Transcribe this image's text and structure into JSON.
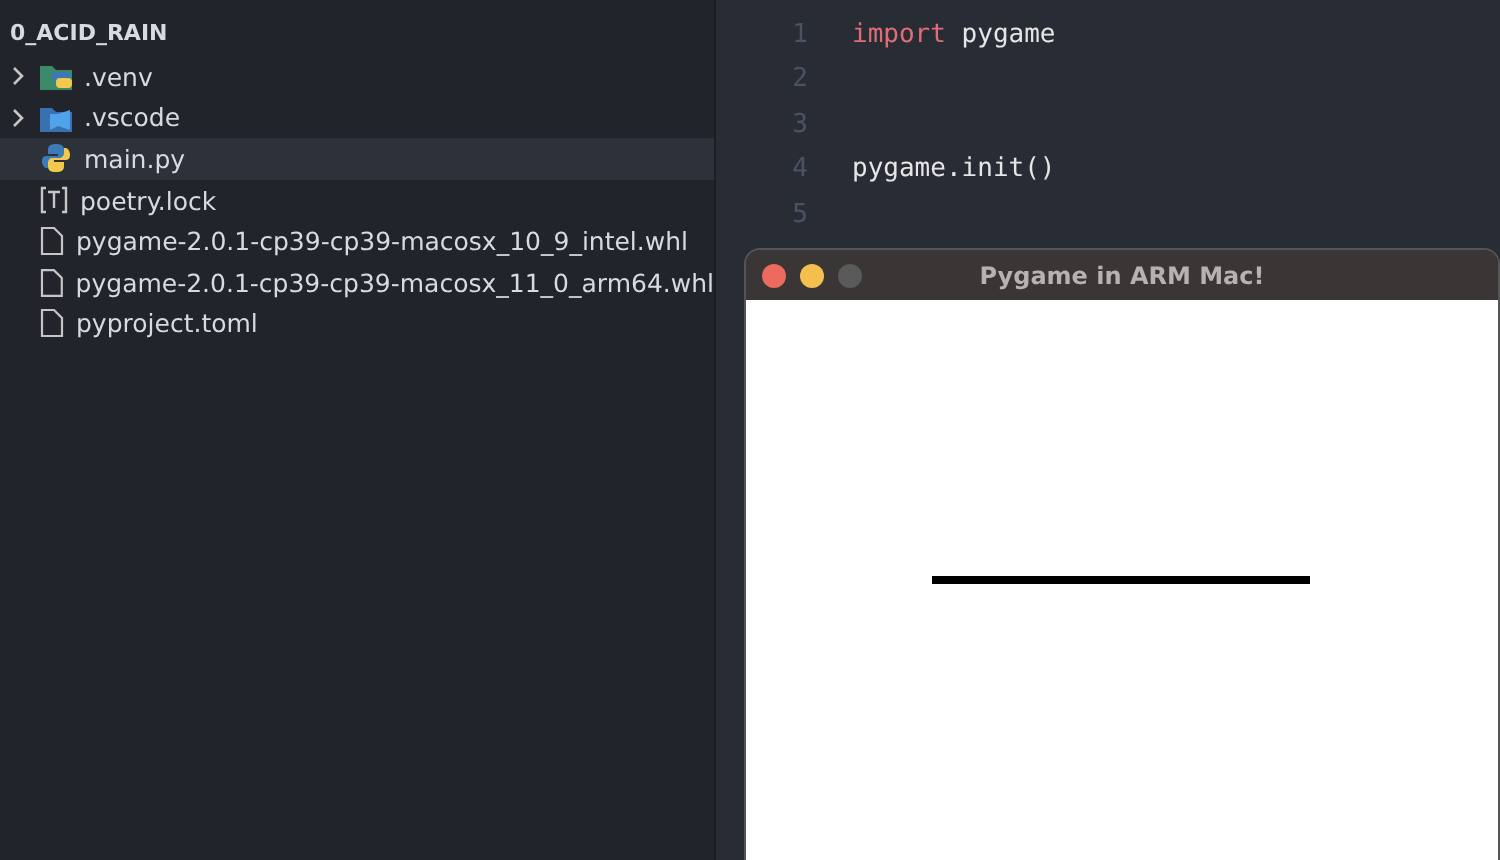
{
  "explorer": {
    "title": "0_ACID_RAIN",
    "items": [
      {
        "name": ".venv",
        "kind": "folder-python",
        "expanded": false,
        "selected": false
      },
      {
        "name": ".vscode",
        "kind": "folder-vscode",
        "expanded": false,
        "selected": false
      },
      {
        "name": "main.py",
        "kind": "python",
        "selected": true
      },
      {
        "name": "poetry.lock",
        "kind": "lock",
        "selected": false
      },
      {
        "name": "pygame-2.0.1-cp39-cp39-macosx_10_9_intel.whl",
        "kind": "file",
        "selected": false
      },
      {
        "name": "pygame-2.0.1-cp39-cp39-macosx_11_0_arm64.whl",
        "kind": "file",
        "selected": false
      },
      {
        "name": "pyproject.toml",
        "kind": "file",
        "selected": false
      }
    ]
  },
  "editor": {
    "lines": [
      {
        "number": "1",
        "tokens": [
          {
            "text": "import",
            "kind": "keyword"
          },
          {
            "text": " pygame",
            "kind": "plain"
          }
        ]
      },
      {
        "number": "2"
      },
      {
        "number": "3"
      },
      {
        "number": "4",
        "tokens": [
          {
            "text": "pygame.init()",
            "kind": "plain"
          }
        ]
      },
      {
        "number": "5"
      }
    ]
  },
  "app_window": {
    "title": "Pygame in ARM Mac!"
  }
}
